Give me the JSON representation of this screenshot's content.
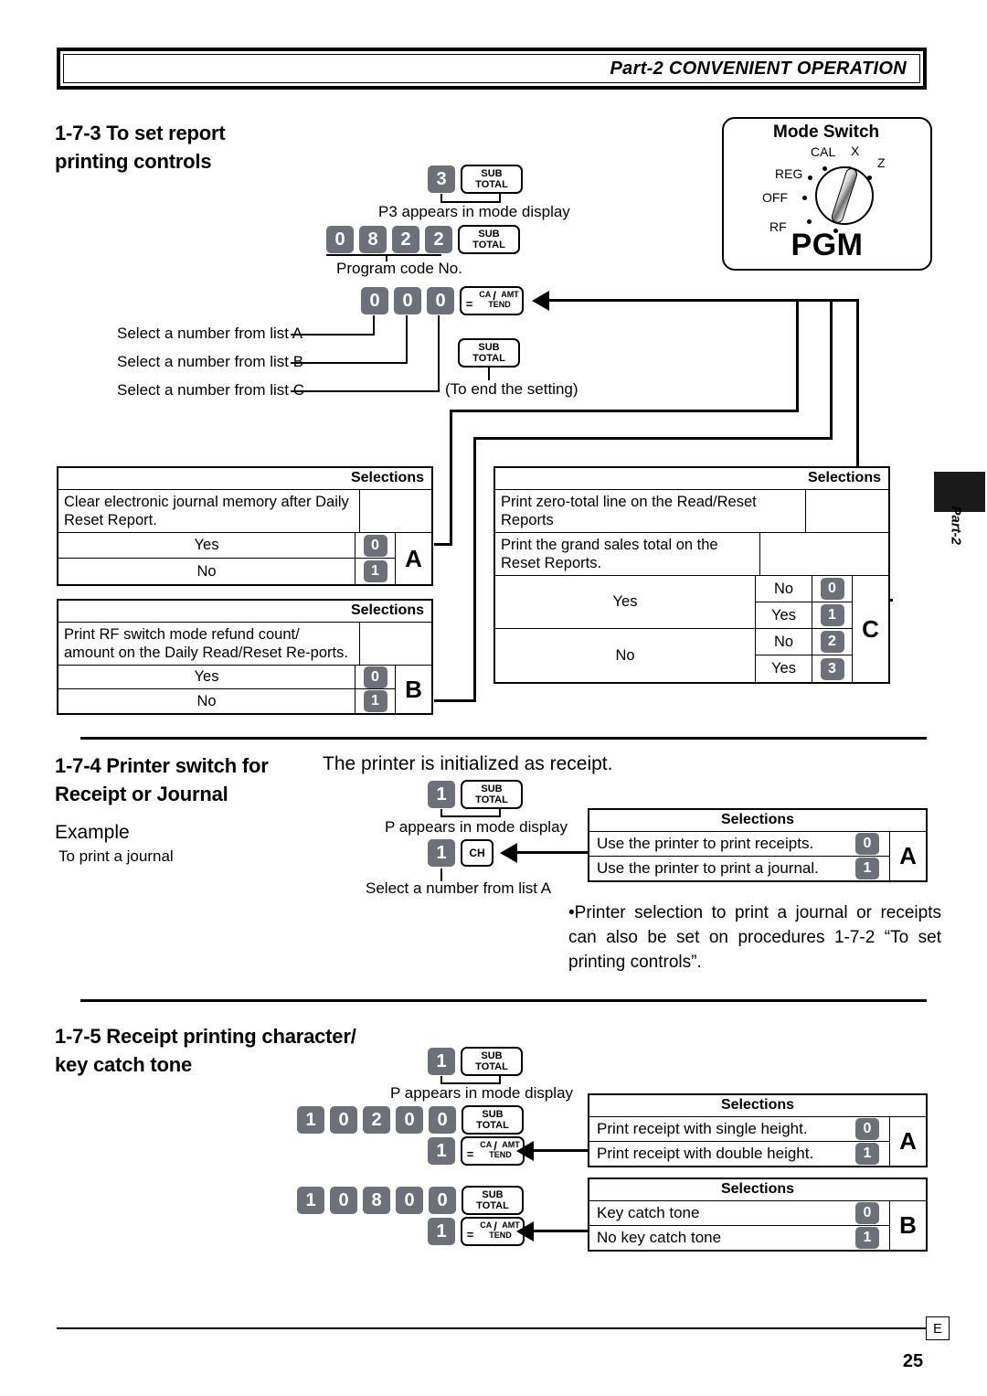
{
  "header": {
    "title": "Part-2 CONVENIENT OPERATION"
  },
  "mode_switch": {
    "label": "Mode Switch",
    "positions": [
      "REG",
      "CAL",
      "X",
      "Z",
      "OFF",
      "RF"
    ],
    "selected": "PGM"
  },
  "section_173": {
    "heading": "1-7-3  To set report\nprinting controls",
    "steps": [
      {
        "keys": [
          "3"
        ],
        "action": "SUB\nTOTAL",
        "caption": "P3 appears in mode display"
      },
      {
        "keys": [
          "0",
          "8",
          "2",
          "2"
        ],
        "action": "SUB\nTOTAL",
        "caption": "Program code No."
      },
      {
        "keys": [
          "0",
          "0",
          "0"
        ],
        "action": "CA/AMT TEND"
      },
      {
        "action": "SUB\nTOTAL",
        "caption": "(To end the setting)"
      }
    ],
    "list_hints": [
      "Select a number from list A",
      "Select a number from list B",
      "Select a number from list C"
    ],
    "table_a": {
      "header": "Selections",
      "question": "Clear electronic journal memory after Daily Reset Report.",
      "rows": [
        {
          "label": "Yes",
          "value": "0"
        },
        {
          "label": "No",
          "value": "1"
        }
      ],
      "letter": "A"
    },
    "table_b": {
      "header": "Selections",
      "question": "Print RF switch mode  refund count/ amount on the Daily Read/Reset Re-ports.",
      "rows": [
        {
          "label": "Yes",
          "value": "0"
        },
        {
          "label": "No",
          "value": "1"
        }
      ],
      "letter": "B"
    },
    "table_c": {
      "header": "Selections",
      "question1": "Print zero-total line on the Read/Reset Reports",
      "question2": "Print the grand sales total on the Reset Reports.",
      "groups": [
        {
          "label": "Yes",
          "sub": [
            {
              "label": "No",
              "value": "0"
            },
            {
              "label": "Yes",
              "value": "1"
            }
          ]
        },
        {
          "label": "No",
          "sub": [
            {
              "label": "No",
              "value": "2"
            },
            {
              "label": "Yes",
              "value": "3"
            }
          ]
        }
      ],
      "letter": "C"
    }
  },
  "section_174": {
    "heading": "1-7-4  Printer switch for\nReceipt or Journal",
    "example_label": "Example",
    "example_text": "To print a journal",
    "intro": "The printer is initialized as receipt.",
    "steps": [
      {
        "keys": [
          "1"
        ],
        "action": "SUB\nTOTAL",
        "caption": "P appears in  mode display"
      },
      {
        "keys": [
          "1"
        ],
        "action": "CH",
        "caption": "Select a number from list A"
      }
    ],
    "table_a": {
      "header": "Selections",
      "rows": [
        {
          "label": "Use the printer to print receipts.",
          "value": "0"
        },
        {
          "label": "Use the printer to print a journal.",
          "value": "1"
        }
      ],
      "letter": "A"
    },
    "note": "•Printer selection to print a journal or receipts can also be set on procedures 1-7-2 “To set printing controls”."
  },
  "section_175": {
    "heading": "1-7-5  Receipt printing character/\nkey catch tone",
    "steps": [
      {
        "keys": [
          "1"
        ],
        "action": "SUB\nTOTAL",
        "caption": "P appears in  mode display"
      },
      {
        "keys": [
          "1",
          "0",
          "2",
          "0",
          "0"
        ],
        "action": "SUB\nTOTAL"
      },
      {
        "keys": [
          "1"
        ],
        "action": "CA/AMT TEND"
      },
      {
        "keys": [
          "1",
          "0",
          "8",
          "0",
          "0"
        ],
        "action": "SUB\nTOTAL"
      },
      {
        "keys": [
          "1"
        ],
        "action": "CA/AMT TEND"
      }
    ],
    "table_a": {
      "header": "Selections",
      "rows": [
        {
          "label": "Print receipt with single height.",
          "value": "0"
        },
        {
          "label": "Print receipt with double height.",
          "value": "1"
        }
      ],
      "letter": "A"
    },
    "table_b": {
      "header": "Selections",
      "rows": [
        {
          "label": "Key catch tone",
          "value": "0"
        },
        {
          "label": "No key catch tone",
          "value": "1"
        }
      ],
      "letter": "B"
    }
  },
  "side_tab": {
    "label": "Part-2"
  },
  "footer": {
    "mark": "E",
    "page_number": "25"
  },
  "keys": {
    "subtotal_line1": "SUB",
    "subtotal_line2": "TOTAL",
    "ch": "CH",
    "tend_eq": "=",
    "tend_ca": "CA",
    "tend_amt": "AMT",
    "tend_tend": "TEND",
    "tend_slash": "/"
  }
}
